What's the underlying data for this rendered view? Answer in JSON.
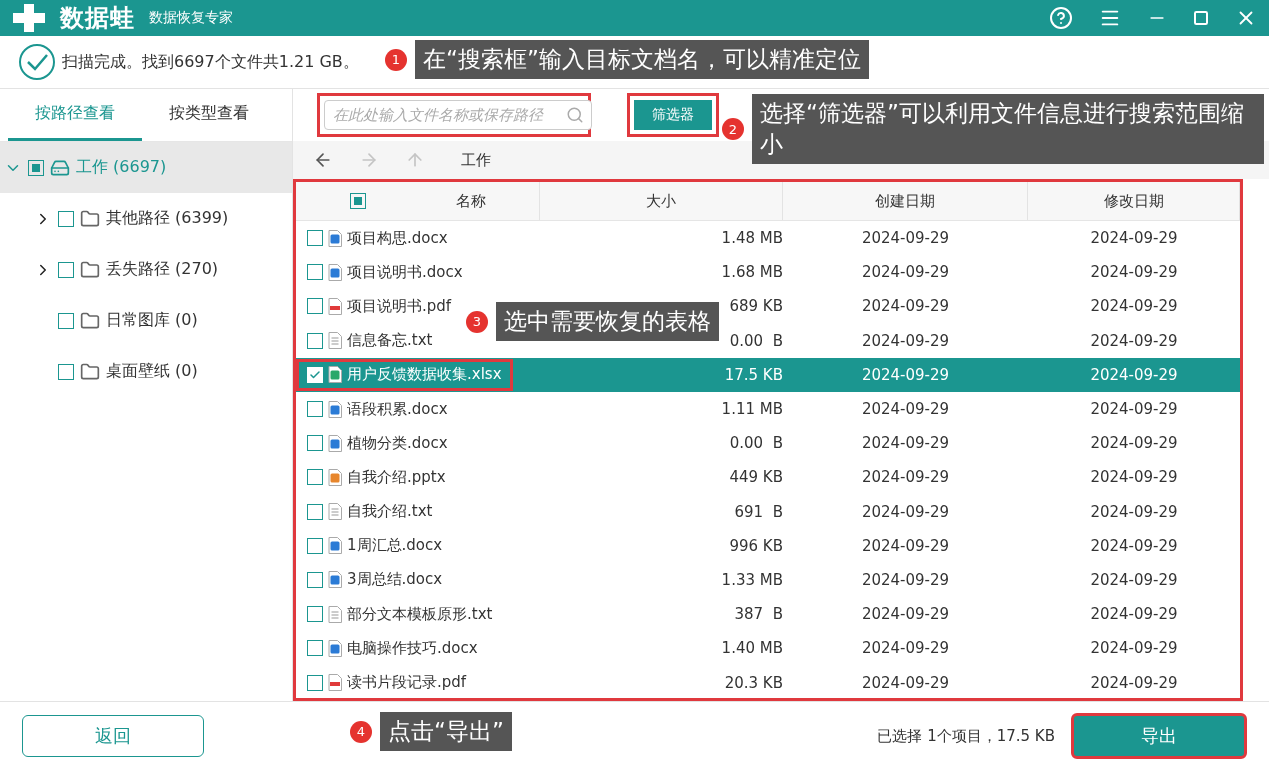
{
  "title_bar": {
    "brand": "数据蛙",
    "subtitle": "数据恢复专家"
  },
  "scan_status": "扫描完成。找到6697个文件共1.21 GB。",
  "view_tabs": [
    {
      "label": "按路径查看",
      "selected": true
    },
    {
      "label": "按类型查看",
      "selected": false
    }
  ],
  "tree": [
    {
      "label": "工作 (6697)",
      "kind": "drive",
      "partial": true,
      "expanded": true,
      "selected": true,
      "children": [
        {
          "label": "其他路径 (6399)",
          "kind": "folder",
          "checked": false,
          "expanded": false,
          "selected": false
        },
        {
          "label": "丢失路径 (270)",
          "kind": "folder",
          "checked": false,
          "expanded": false,
          "selected": false
        },
        {
          "label": "日常图库 (0)",
          "kind": "folder",
          "checked": false,
          "selected": false
        },
        {
          "label": "桌面壁纸 (0)",
          "kind": "folder",
          "checked": false,
          "selected": false
        }
      ]
    }
  ],
  "search": {
    "placeholder": "在此处输入文件名称或保存路径",
    "highlighted": true
  },
  "filter_button": {
    "label": "筛选器",
    "highlighted": true
  },
  "nav": {
    "back_disabled": false,
    "forward_disabled": true,
    "up_disabled": true,
    "path": "工作"
  },
  "table": {
    "highlighted": true,
    "header_partial": true,
    "columns": [
      "名称",
      "大小",
      "创建日期",
      "修改日期"
    ],
    "rows": [
      {
        "kind": "word",
        "name": "项目构思.docx",
        "size": "1.48 MB",
        "created": "2024-09-29",
        "modified": "2024-09-29",
        "checked": false,
        "selected": false,
        "highlighted": false
      },
      {
        "kind": "word",
        "name": "项目说明书.docx",
        "size": "1.68 MB",
        "created": "2024-09-29",
        "modified": "2024-09-29",
        "checked": false,
        "selected": false,
        "highlighted": false
      },
      {
        "kind": "pdf",
        "name": "项目说明书.pdf",
        "size": "689 KB",
        "created": "2024-09-29",
        "modified": "2024-09-29",
        "checked": false,
        "selected": false,
        "highlighted": false
      },
      {
        "kind": "text",
        "name": "信息备忘.txt",
        "size": "0.00  B",
        "created": "2024-09-29",
        "modified": "2024-09-29",
        "checked": false,
        "selected": false,
        "highlighted": false
      },
      {
        "kind": "sheet",
        "name": "用户反馈数据收集.xlsx",
        "size": "17.5 KB",
        "created": "2024-09-29",
        "modified": "2024-09-29",
        "checked": true,
        "selected": true,
        "highlighted": true
      },
      {
        "kind": "word",
        "name": "语段积累.docx",
        "size": "1.11 MB",
        "created": "2024-09-29",
        "modified": "2024-09-29",
        "checked": false,
        "selected": false,
        "highlighted": false
      },
      {
        "kind": "word",
        "name": "植物分类.docx",
        "size": "0.00  B",
        "created": "2024-09-29",
        "modified": "2024-09-29",
        "checked": false,
        "selected": false,
        "highlighted": false
      },
      {
        "kind": "slides",
        "name": "自我介绍.pptx",
        "size": "449 KB",
        "created": "2024-09-29",
        "modified": "2024-09-29",
        "checked": false,
        "selected": false,
        "highlighted": false
      },
      {
        "kind": "text",
        "name": "自我介绍.txt",
        "size": "691  B",
        "created": "2024-09-29",
        "modified": "2024-09-29",
        "checked": false,
        "selected": false,
        "highlighted": false
      },
      {
        "kind": "word",
        "name": "1周汇总.docx",
        "size": "996 KB",
        "created": "2024-09-29",
        "modified": "2024-09-29",
        "checked": false,
        "selected": false,
        "highlighted": false
      },
      {
        "kind": "word",
        "name": "3周总结.docx",
        "size": "1.33 MB",
        "created": "2024-09-29",
        "modified": "2024-09-29",
        "checked": false,
        "selected": false,
        "highlighted": false
      },
      {
        "kind": "text",
        "name": "部分文本模板原形.txt",
        "size": "387  B",
        "created": "2024-09-29",
        "modified": "2024-09-29",
        "checked": false,
        "selected": false,
        "highlighted": false
      },
      {
        "kind": "word",
        "name": "电脑操作技巧.docx",
        "size": "1.40 MB",
        "created": "2024-09-29",
        "modified": "2024-09-29",
        "checked": false,
        "selected": false,
        "highlighted": false
      },
      {
        "kind": "pdf",
        "name": "读书片段记录.pdf",
        "size": "20.3 KB",
        "created": "2024-09-29",
        "modified": "2024-09-29",
        "checked": false,
        "selected": false,
        "highlighted": false
      }
    ]
  },
  "footer": {
    "back_button": "返回",
    "selection_info": "已选择 1个项目，17.5 KB",
    "export_button": {
      "label": "导出",
      "highlighted": true
    }
  },
  "callouts": [
    {
      "number": "1",
      "text": "在“搜索框”输入目标文档名，可以精准定位"
    },
    {
      "number": "2",
      "text": "选择“筛选器”可以利用文件信息进行搜索范围缩小"
    },
    {
      "number": "3",
      "text": "选中需要恢复的表格"
    },
    {
      "number": "4",
      "text": "点击“导出”"
    }
  ]
}
